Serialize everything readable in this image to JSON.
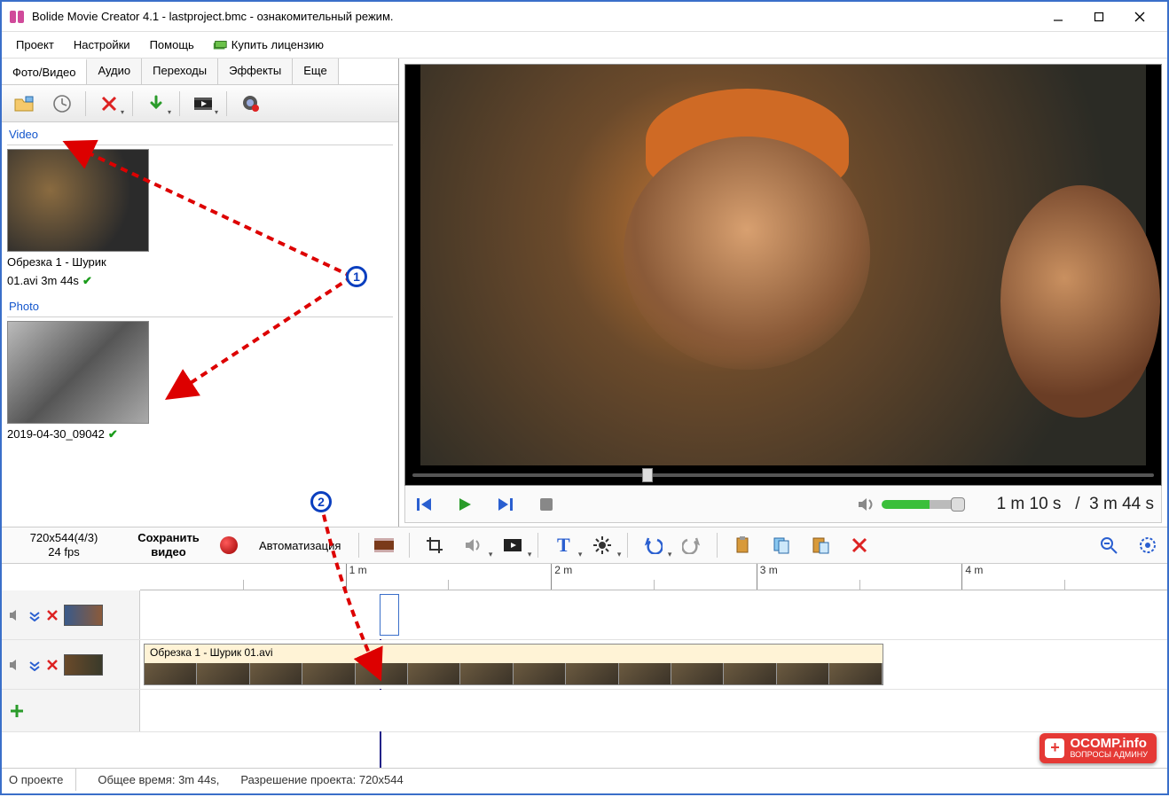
{
  "window": {
    "title": "Bolide Movie Creator 4.1 - lastproject.bmc  - ознакомительный режим."
  },
  "menu": {
    "project": "Проект",
    "settings": "Настройки",
    "help": "Помощь",
    "buy": "Купить лицензию"
  },
  "tabs": {
    "photovideo": "Фото/Видео",
    "audio": "Аудио",
    "transitions": "Переходы",
    "effects": "Эффекты",
    "more": "Еще"
  },
  "library": {
    "video_header": "Video",
    "photo_header": "Photo",
    "video_item": {
      "line1": "Обрезка 1 - Шурик",
      "line2": "01.avi 3m 44s"
    },
    "photo_item": {
      "caption": "2019-04-30_09042"
    }
  },
  "transport": {
    "current": "1 m 10 s",
    "sep": "/",
    "total": "3 m 44 s"
  },
  "project": {
    "res": "720x544(4/3)",
    "fps": "24 fps",
    "save_l1": "Сохранить",
    "save_l2": "видео",
    "automation": "Автоматизация"
  },
  "ruler": {
    "m1": "1 m",
    "m2": "2 m",
    "m3": "3 m",
    "m4": "4 m"
  },
  "timeline": {
    "clip1": "Обрезка 1 - Шурик 01.avi"
  },
  "status": {
    "about": "О проекте",
    "totaltime": "Общее время: 3m 44s,",
    "projres": "Разрешение проекта:   720x544"
  },
  "watermark": {
    "main": "OCOMP.info",
    "sub": "ВОПРОСЫ АДМИНУ"
  },
  "annotations": {
    "b1": "1",
    "b2": "2"
  }
}
